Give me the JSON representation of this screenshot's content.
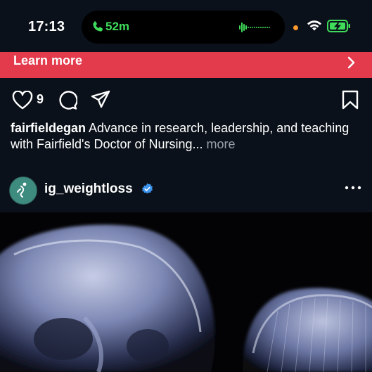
{
  "status_bar": {
    "time": "17:13",
    "call_duration": "52m",
    "icons": [
      "phone-icon",
      "waveform-icon",
      "privacy-dot",
      "wifi-icon",
      "battery-charging-icon"
    ],
    "call_color": "#3fdc5b"
  },
  "ad": {
    "label": "Learn more",
    "icon": "chevron-right-icon",
    "color": "#e33a4c"
  },
  "post_actions": {
    "like_count": "9",
    "icons": [
      "heart-icon",
      "comment-icon",
      "share-icon",
      "bookmark-icon"
    ]
  },
  "caption": {
    "username": "fairfieldegan",
    "text": " Advance in research, leadership, and teaching with Fairfield's Doctor of Nursing... ",
    "more_label": "more"
  },
  "next_post": {
    "username": "ig_weightloss",
    "verified_icon": "verified-badge-icon",
    "menu_icon": "more-options-icon",
    "image_icon": "xray-skull-image"
  }
}
